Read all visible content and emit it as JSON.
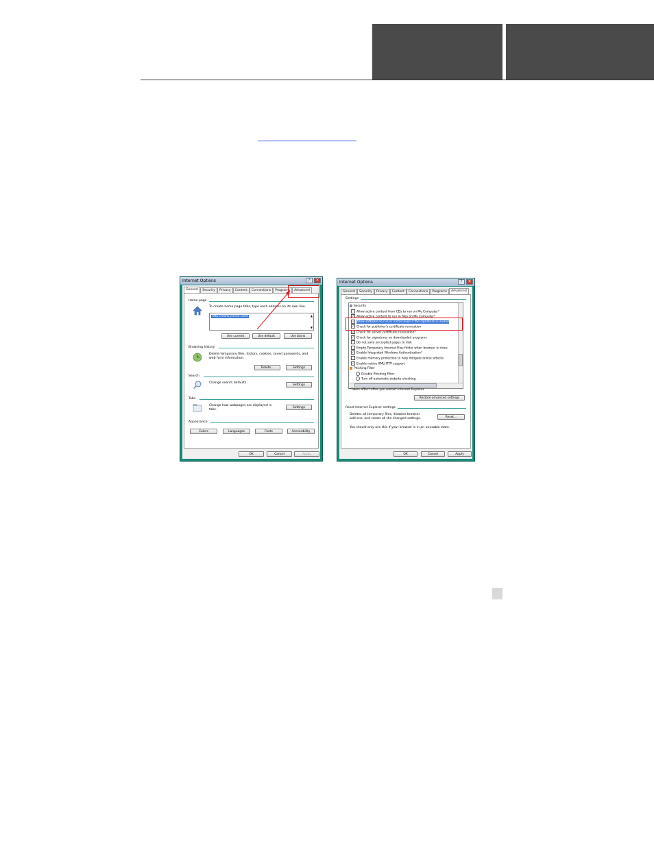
{
  "colors": {
    "dialog_frame": "#188a78",
    "header_block": "#4a4a4a",
    "highlight_box": "#e0101a",
    "link": "#2a4fd8"
  },
  "dialog_left": {
    "title": "Internet Options",
    "tabs": [
      "General",
      "Security",
      "Privacy",
      "Content",
      "Connections",
      "Programs",
      "Advanced"
    ],
    "home_page": {
      "group": "Home page",
      "desc": "To create home page tabs, type each address on its own line.",
      "url": "http://www.yahoo.com/",
      "buttons": [
        "Use current",
        "Use default",
        "Use blank"
      ]
    },
    "browsing_history": {
      "group": "Browsing history",
      "desc": "Delete temporary files, history, cookies, saved passwords, and web form information.",
      "buttons": [
        "Delete...",
        "Settings"
      ]
    },
    "search": {
      "group": "Search",
      "desc": "Change search defaults.",
      "button": "Settings"
    },
    "tabs_group": {
      "group": "Tabs",
      "desc": "Change how webpages are displayed in tabs.",
      "button": "Settings"
    },
    "appearance": {
      "group": "Appearance",
      "buttons": [
        "Colors",
        "Languages",
        "Fonts",
        "Accessibility"
      ]
    },
    "footer": [
      "OK",
      "Cancel",
      "Apply"
    ]
  },
  "dialog_right": {
    "title": "Internet Options",
    "tabs": [
      "General",
      "Security",
      "Privacy",
      "Content",
      "Connections",
      "Programs",
      "Advanced"
    ],
    "settings_group": "Settings",
    "items": [
      {
        "label": "Security",
        "checked": null
      },
      {
        "label": "Allow active content from CDs to run on My Computer*",
        "checked": false
      },
      {
        "label": "Allow active content to run in files on My Computer*",
        "checked": true
      },
      {
        "label": "Allow software to run or install even if the signature is invalid",
        "checked": true
      },
      {
        "label": "Check for publisher's certificate revocation",
        "checked": true
      },
      {
        "label": "Check for server certificate revocation*",
        "checked": true
      },
      {
        "label": "Check for signatures on downloaded programs",
        "checked": true
      },
      {
        "label": "Do not save encrypted pages to disk",
        "checked": false
      },
      {
        "label": "Empty Temporary Internet Files folder when browser is close",
        "checked": false
      },
      {
        "label": "Enable Integrated Windows Authentication*",
        "checked": true
      },
      {
        "label": "Enable memory protection to help mitigate online attacks",
        "checked": false
      },
      {
        "label": "Enable native XMLHTTP support",
        "checked": true
      },
      {
        "label": "Phishing Filter",
        "checked": null
      },
      {
        "label": "Disable Phishing Filter",
        "checked": false
      },
      {
        "label": "Turn off automatic website checking",
        "checked": false
      }
    ],
    "restart_note": "*Takes effect after you restart Internet Explorer",
    "restore_button": "Restore advanced settings",
    "reset_group": "Reset Internet Explorer settings",
    "reset_desc": "Deletes all temporary files, disables browser add-ons, and resets all the changed settings.",
    "reset_button": "Reset...",
    "reset_warning": "You should only use this if your browser is in an unusable state.",
    "footer": [
      "OK",
      "Cancel",
      "Apply"
    ]
  }
}
